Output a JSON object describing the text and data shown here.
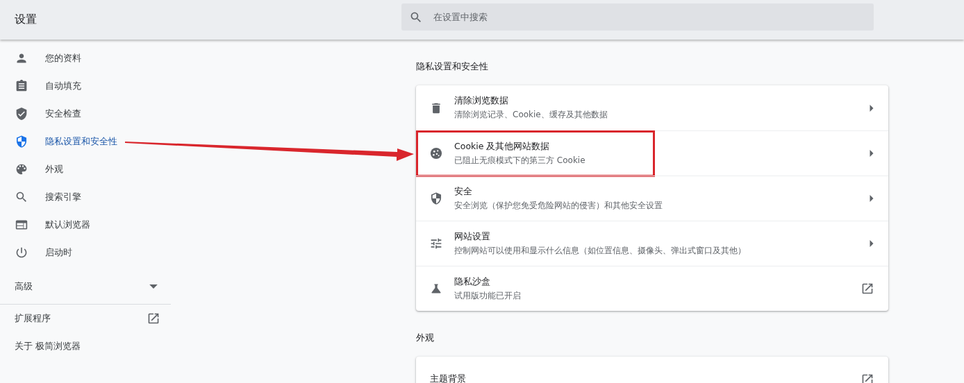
{
  "header": {
    "title": "设置",
    "search": {
      "placeholder": "在设置中搜索"
    }
  },
  "sidebar": {
    "items": [
      {
        "label": "您的资料",
        "selected": false
      },
      {
        "label": "自动填充",
        "selected": false
      },
      {
        "label": "安全检查",
        "selected": false
      },
      {
        "label": "隐私设置和安全性",
        "selected": true
      },
      {
        "label": "外观",
        "selected": false
      },
      {
        "label": "搜索引擎",
        "selected": false
      },
      {
        "label": "默认浏览器",
        "selected": false
      },
      {
        "label": "启动时",
        "selected": false
      }
    ],
    "advanced": {
      "label": "高级",
      "expanded": false
    },
    "links": [
      {
        "label": "扩展程序",
        "kind": "external"
      },
      {
        "label": "关于 极简浏览器",
        "kind": "plain"
      }
    ]
  },
  "sections": [
    {
      "title": "隐私设置和安全性",
      "rows": [
        {
          "title": "清除浏览数据",
          "subtitle": "清除浏览记录、Cookie、缓存及其他数据",
          "kind": "submenu",
          "highlighted": false
        },
        {
          "title": "Cookie 及其他网站数据",
          "subtitle": "已阻止无痕模式下的第三方 Cookie",
          "kind": "submenu",
          "highlighted": true
        },
        {
          "title": "安全",
          "subtitle": "安全浏览（保护您免受危险网站的侵害）和其他安全设置",
          "kind": "submenu",
          "highlighted": false
        },
        {
          "title": "网站设置",
          "subtitle": "控制网站可以使用和显示什么信息（如位置信息、摄像头、弹出式窗口及其他）",
          "kind": "submenu",
          "highlighted": false
        },
        {
          "title": "隐私沙盒",
          "subtitle": "试用版功能已开启",
          "kind": "external",
          "highlighted": false
        }
      ]
    },
    {
      "title": "外观",
      "rows": [
        {
          "title": "主题背景",
          "kind": "external",
          "highlighted": false
        }
      ]
    }
  ],
  "annotation": {
    "arrow": true
  }
}
